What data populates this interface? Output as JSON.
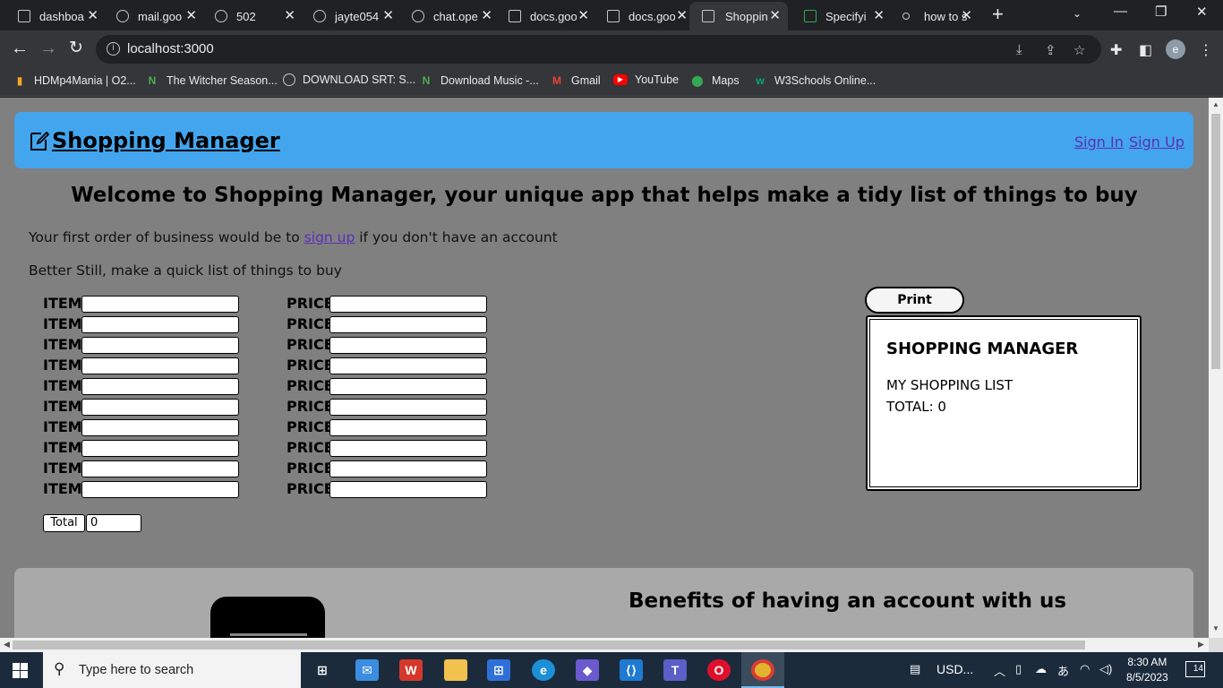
{
  "browser": {
    "tabs": [
      {
        "title": "dashboa"
      },
      {
        "title": "mail.goo"
      },
      {
        "title": "502"
      },
      {
        "title": "jayte054"
      },
      {
        "title": "chat.ope"
      },
      {
        "title": "docs.goo"
      },
      {
        "title": "docs.goo"
      },
      {
        "title": "Shoppin",
        "active": true
      },
      {
        "title": "Specifyi"
      },
      {
        "title": "how to s"
      }
    ],
    "url": "localhost:3000",
    "profile_initial": "e",
    "bookmarks": [
      {
        "label": "HDMp4Mania | O2...",
        "icon": "signal-bars-icon"
      },
      {
        "label": "The Witcher Season...",
        "icon": "n-logo-icon"
      },
      {
        "label": "DOWNLOAD SRT: S...",
        "icon": "globe-icon"
      },
      {
        "label": "Download Music -...",
        "icon": "n-logo-icon"
      },
      {
        "label": "Gmail",
        "icon": "gmail-icon"
      },
      {
        "label": "YouTube",
        "icon": "youtube-icon"
      },
      {
        "label": "Maps",
        "icon": "maps-icon"
      },
      {
        "label": "W3Schools Online...",
        "icon": "w3schools-icon"
      }
    ]
  },
  "page": {
    "brand": "Shopping Manager",
    "sign_in": "Sign In",
    "sign_up": "Sign Up",
    "welcome": "Welcome to Shopping Manager, your unique app that helps make a tidy list of things to buy",
    "intro_before": "Your first order of business would be to ",
    "intro_link": "sign up",
    "intro_after": " if you don't have an account",
    "quick_list": "Better Still, make a quick list of things to buy",
    "item_label": "ITEM",
    "price_label": "PRICE",
    "rows": 10,
    "total_label": "Total",
    "total_value": "0",
    "print_label": "Print",
    "receipt": {
      "title": "SHOPPING MANAGER",
      "subtitle": "MY SHOPPING LIST",
      "total": "TOTAL: 0"
    },
    "benefits_title": "Benefits of having an account with us"
  },
  "taskbar": {
    "search_placeholder": "Type here to search",
    "currency": "USD...",
    "time": "8:30 AM",
    "date": "8/5/2023",
    "notifications": "14"
  },
  "colors": {
    "header_bg": "#43a5ee",
    "page_bg": "#808080",
    "benefits_bg": "#a9a9a9",
    "link": "#5b2fb8"
  }
}
